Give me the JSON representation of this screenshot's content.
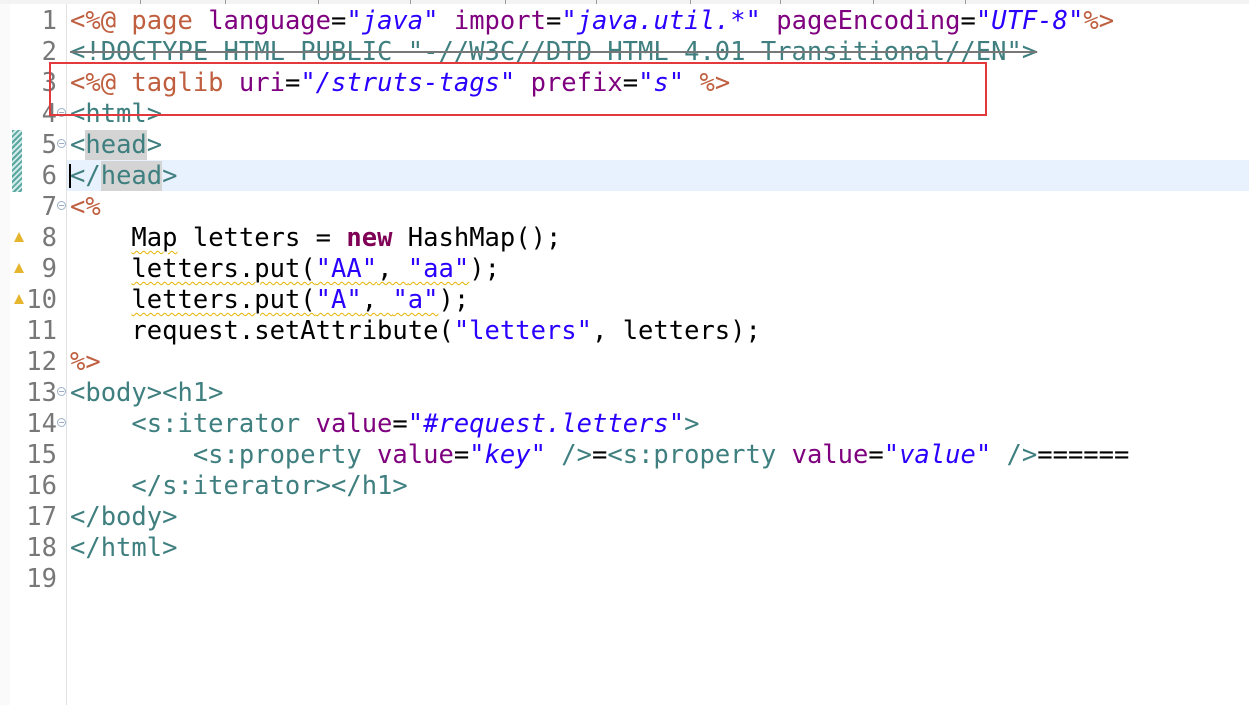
{
  "editor": {
    "lines": [
      {
        "n": "1",
        "tokens": [
          {
            "t": "<%@ ",
            "c": "dir"
          },
          {
            "t": "page ",
            "c": "dir"
          },
          {
            "t": "language",
            "c": "attr"
          },
          {
            "t": "=",
            "c": "plain"
          },
          {
            "t": "\"java\"",
            "c": "val"
          },
          {
            "t": " import",
            "c": "attr"
          },
          {
            "t": "=",
            "c": "plain"
          },
          {
            "t": "\"java.util.*\"",
            "c": "val"
          },
          {
            "t": " pageEncoding",
            "c": "attr"
          },
          {
            "t": "=",
            "c": "plain"
          },
          {
            "t": "\"UTF-8\"",
            "c": "val"
          },
          {
            "t": "%>",
            "c": "dir"
          }
        ]
      },
      {
        "n": "2",
        "tokens": [
          {
            "t": "<!DOCTYPE HTML PUBLIC \"-//W3C//DTD HTML 4.01 Transitional//EN\">",
            "c": "tag"
          }
        ]
      },
      {
        "n": "3",
        "tokens": [
          {
            "t": "<%@ ",
            "c": "dir"
          },
          {
            "t": "taglib ",
            "c": "dir"
          },
          {
            "t": "uri",
            "c": "attr"
          },
          {
            "t": "=",
            "c": "plain"
          },
          {
            "t": "\"/struts-tags\"",
            "c": "val"
          },
          {
            "t": " prefix",
            "c": "attr"
          },
          {
            "t": "=",
            "c": "plain"
          },
          {
            "t": "\"s\"",
            "c": "val"
          },
          {
            "t": " %>",
            "c": "dir"
          }
        ]
      },
      {
        "n": "4",
        "fold": true,
        "tokens": [
          {
            "t": "<html>",
            "c": "tag"
          }
        ]
      },
      {
        "n": "5",
        "fold": true,
        "tokens": [
          {
            "t": "<",
            "c": "tag"
          },
          {
            "t": "head",
            "c": "tag-hl"
          },
          {
            "t": ">",
            "c": "tag"
          }
        ]
      },
      {
        "n": "6",
        "tokens": [
          {
            "t": "</",
            "c": "tag"
          },
          {
            "t": "head",
            "c": "tag-hl"
          },
          {
            "t": ">",
            "c": "tag"
          }
        ]
      },
      {
        "n": "7",
        "fold": true,
        "tokens": [
          {
            "t": "<%",
            "c": "dir"
          }
        ]
      },
      {
        "n": "8",
        "warn": true,
        "tokens": [
          {
            "t": "    ",
            "c": "plain"
          },
          {
            "t": "Map",
            "c": "sq"
          },
          {
            "t": " letters = ",
            "c": "plain"
          },
          {
            "t": "new",
            "c": "kw"
          },
          {
            "t": " HashMap();",
            "c": "plain"
          }
        ]
      },
      {
        "n": "9",
        "warn": true,
        "tokens": [
          {
            "t": "    ",
            "c": "plain"
          },
          {
            "t": "letters.put(",
            "c": "sq"
          },
          {
            "t": "\"AA\"",
            "c": "sqstr"
          },
          {
            "t": ", ",
            "c": "sq"
          },
          {
            "t": "\"aa\"",
            "c": "sqstr"
          },
          {
            "t": ");",
            "c": "plain"
          }
        ]
      },
      {
        "n": "10",
        "warn": true,
        "tokens": [
          {
            "t": "    ",
            "c": "plain"
          },
          {
            "t": "letters.put(",
            "c": "sq"
          },
          {
            "t": "\"A\"",
            "c": "sqstr"
          },
          {
            "t": ", ",
            "c": "sq"
          },
          {
            "t": "\"a\"",
            "c": "sqstr"
          },
          {
            "t": ");",
            "c": "plain"
          }
        ]
      },
      {
        "n": "11",
        "tokens": [
          {
            "t": "    request.setAttribute(",
            "c": "plain"
          },
          {
            "t": "\"letters\"",
            "c": "str"
          },
          {
            "t": ", letters);",
            "c": "plain"
          }
        ]
      },
      {
        "n": "12",
        "tokens": [
          {
            "t": "%>",
            "c": "dir"
          }
        ]
      },
      {
        "n": "13",
        "fold": true,
        "tokens": [
          {
            "t": "<body><h1>",
            "c": "tag"
          }
        ]
      },
      {
        "n": "14",
        "fold": true,
        "tokens": [
          {
            "t": "    <s:iterator ",
            "c": "tag"
          },
          {
            "t": "value",
            "c": "attr"
          },
          {
            "t": "=",
            "c": "plain"
          },
          {
            "t": "\"#request.letters\"",
            "c": "val"
          },
          {
            "t": ">",
            "c": "tag"
          }
        ]
      },
      {
        "n": "15",
        "tokens": [
          {
            "t": "        <s:property ",
            "c": "tag"
          },
          {
            "t": "value",
            "c": "attr"
          },
          {
            "t": "=",
            "c": "plain"
          },
          {
            "t": "\"key\"",
            "c": "val"
          },
          {
            "t": " />",
            "c": "tag"
          },
          {
            "t": "=",
            "c": "plain"
          },
          {
            "t": "<s:property ",
            "c": "tag"
          },
          {
            "t": "value",
            "c": "attr"
          },
          {
            "t": "=",
            "c": "plain"
          },
          {
            "t": "\"value\"",
            "c": "val"
          },
          {
            "t": " />",
            "c": "tag"
          },
          {
            "t": "======",
            "c": "plain"
          }
        ]
      },
      {
        "n": "16",
        "tokens": [
          {
            "t": "    </s:iterator></h1>",
            "c": "tag"
          }
        ]
      },
      {
        "n": "17",
        "tokens": [
          {
            "t": "</body>",
            "c": "tag"
          }
        ]
      },
      {
        "n": "18",
        "tokens": [
          {
            "t": "</html>",
            "c": "tag"
          }
        ]
      },
      {
        "n": "19",
        "tokens": []
      }
    ],
    "current_line": 6,
    "highlighted_line": 3,
    "colors": {
      "directive": "#bf5f3f",
      "tag": "#3f7f7f",
      "attribute": "#7f007f",
      "value": "#2a00ff",
      "keyword": "#7f0055",
      "highlight_box": "#e4393c",
      "current_line_bg": "#e8f2fe"
    }
  }
}
